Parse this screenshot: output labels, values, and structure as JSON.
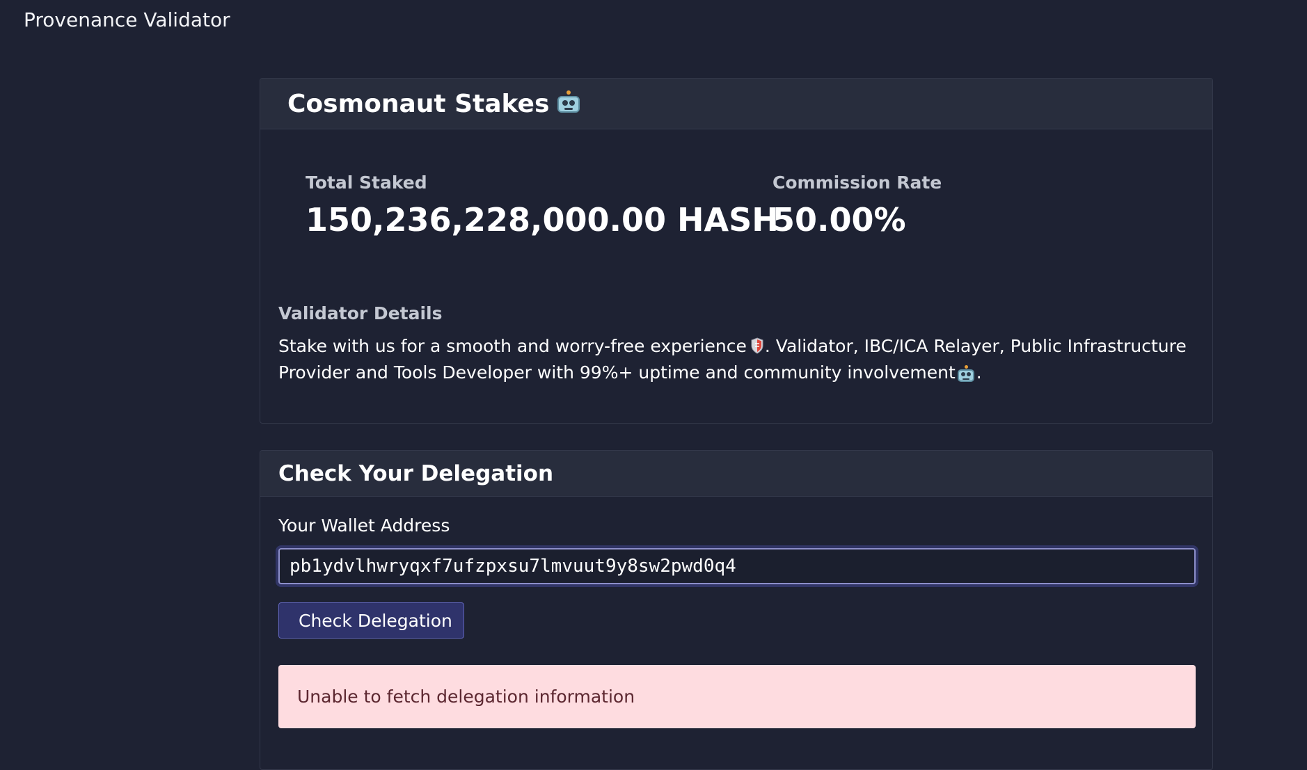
{
  "app": {
    "title": "Provenance Validator"
  },
  "validator": {
    "name": "Cosmonaut Stakes",
    "name_icon": "robot-icon",
    "stats": {
      "total_staked_label": "Total Staked",
      "total_staked_value": "150,236,228,000.00 HASH",
      "commission_label": "Commission Rate",
      "commission_value": "50.00%"
    },
    "details": {
      "label": "Validator Details",
      "text_part1": "Stake with us for a smooth and worry-free experience",
      "text_part2": ". Validator, IBC/ICA Relayer, Public Infrastructure Provider and Tools Developer with 99%+ uptime and community involvement",
      "text_part3": ".",
      "icons": [
        "shield-icon",
        "robot-icon"
      ]
    }
  },
  "delegation": {
    "title": "Check Your Delegation",
    "wallet_label": "Your Wallet Address",
    "wallet_value": "pb1ydvlhwryqxf7ufzpxsu7lmvuut9y8sw2pwd0q4",
    "button_label": "Check Delegation",
    "error_message": "Unable to fetch delegation information"
  },
  "colors": {
    "background": "#1e2233",
    "card_header": "#282d3d",
    "button": "#2f336b",
    "alert_background": "#fedce0",
    "alert_text": "#5c2730"
  }
}
